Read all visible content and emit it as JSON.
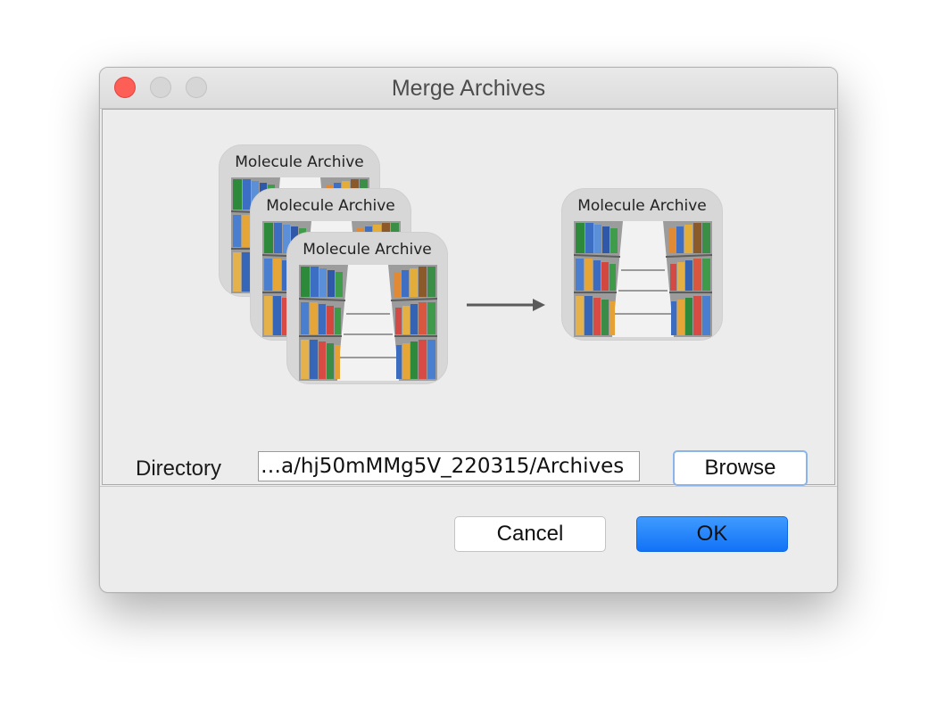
{
  "window": {
    "title": "Merge Archives"
  },
  "illustration": {
    "source_cards": [
      {
        "label": "Molecule Archive"
      },
      {
        "label": "Molecule Archive"
      },
      {
        "label": "Molecule Archive"
      }
    ],
    "result_card": {
      "label": "Molecule Archive"
    },
    "arrow_icon": "right-arrow-icon",
    "card_image_icon": "library-bookshelves-icon"
  },
  "directory": {
    "label": "Directory",
    "value": "…a/hj50mMMg5V_220315/Archives"
  },
  "buttons": {
    "browse": "Browse",
    "cancel": "Cancel",
    "ok": "OK"
  },
  "colors": {
    "close_button": "#fd5e56",
    "ok_button": "#1a7cfb",
    "browse_focus_ring": "#8ab4ea"
  }
}
